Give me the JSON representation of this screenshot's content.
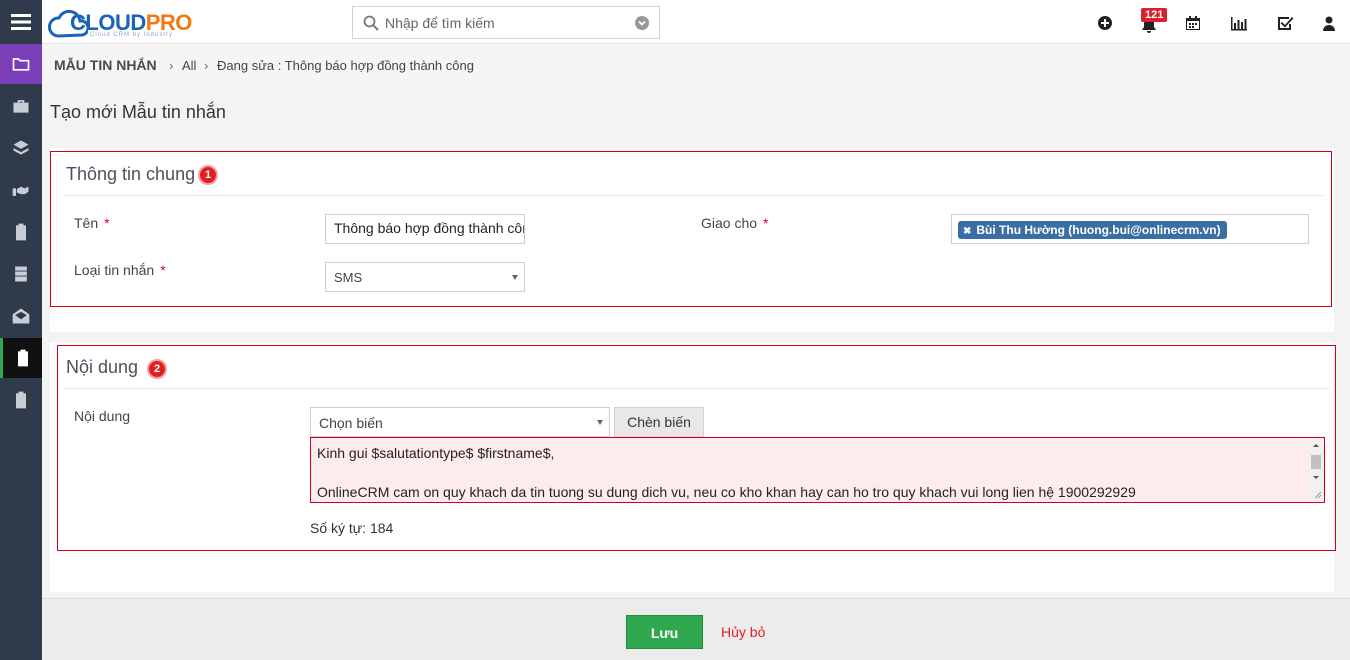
{
  "app": {
    "logo_cloud": "CLOUD",
    "logo_pro": "PRO",
    "logo_tagline": "Cloud CRM by Industry"
  },
  "search": {
    "placeholder": "Nhập để tìm kiếm"
  },
  "header": {
    "notification_count": "121"
  },
  "breadcrumb": {
    "module": "MẪU TIN NHẮN",
    "all": "All",
    "current": "Đang sửa : Thông báo hợp đồng thành công"
  },
  "page": {
    "title": "Tạo mới Mẫu tin nhắn"
  },
  "section_general": {
    "title": "Thông tin chung",
    "badge": "1",
    "name_label": "Tên",
    "name_value": "Thông báo hợp đồng thành công",
    "type_label": "Loại tin nhắn",
    "type_value": "SMS",
    "assign_label": "Giao cho",
    "assign_tag": "Bùi Thu Hường (huong.bui@onlinecrm.vn)",
    "required_mark": "*"
  },
  "section_content": {
    "title": "Nội dung",
    "badge": "2",
    "content_label": "Nội dung",
    "variable_select": "Chọn biến",
    "insert_button": "Chèn biến",
    "line1": "Kinh gui $salutationtype$ $firstname$,",
    "line2": "OnlineCRM cam on quy khach da tin tuong su dung dich vu, neu co kho khan hay can ho tro quy khach vui long lien hệ 1900292929",
    "char_count": "Số ký tự: 184"
  },
  "footer": {
    "save": "Lưu",
    "cancel": "Hủy bỏ"
  },
  "colors": {
    "sidebar": "#2f3b4a",
    "accent_purple": "#7a3fb8",
    "save_green": "#2fa84f",
    "required_red": "#d0021b",
    "brand_blue": "#1a64b5",
    "brand_orange": "#f07a12"
  }
}
